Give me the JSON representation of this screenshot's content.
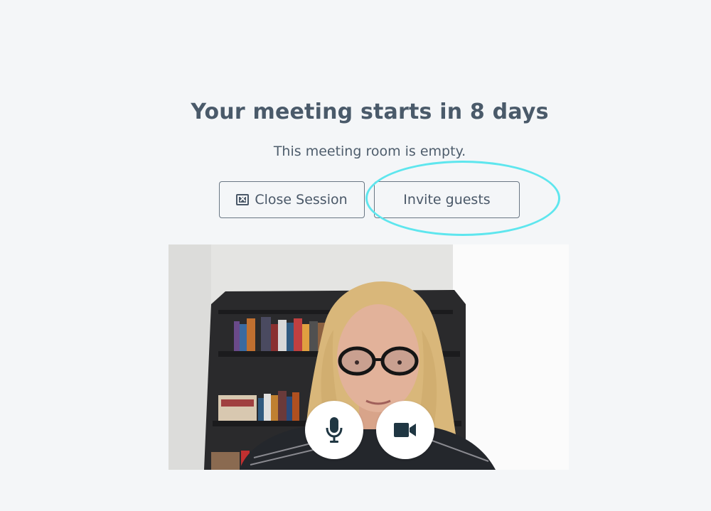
{
  "meeting": {
    "title": "Your meeting starts in 8 days",
    "status": "This meeting room is empty."
  },
  "actions": {
    "close_session_label": "Close Session",
    "invite_guests_label": "Invite guests"
  },
  "icons": {
    "close_session": "close-box-icon",
    "microphone": "microphone-icon",
    "camera": "video-camera-icon"
  },
  "colors": {
    "background": "#f4f6f8",
    "text": "#4a5a6a",
    "highlight": "#5ee6ee",
    "icon": "#1f3642"
  }
}
